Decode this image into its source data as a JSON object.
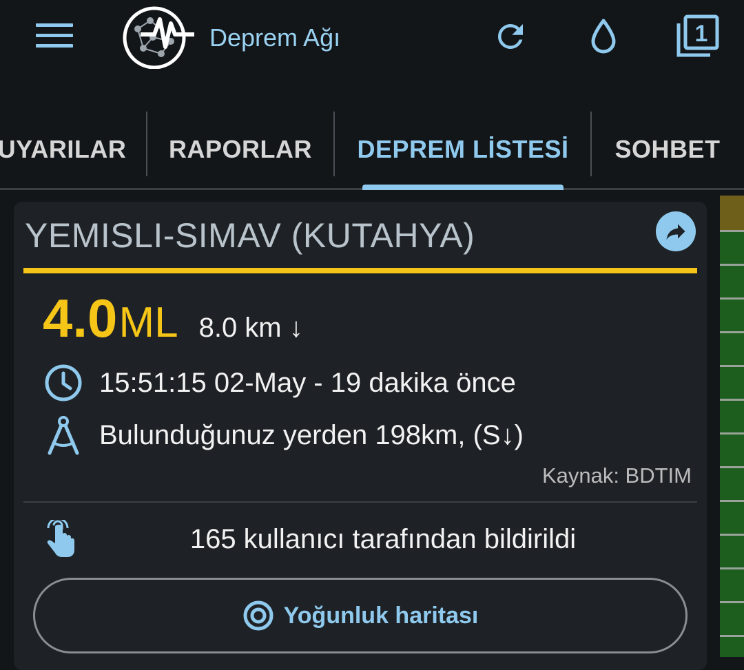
{
  "appbar": {
    "title": "Deprem Ağı",
    "icons": {
      "menu": "hamburger-menu-icon",
      "logo": "earthquake-network-logo",
      "refresh": "refresh-icon",
      "drop": "water-drop-icon",
      "filter": "filter-one-icon"
    },
    "badge_count": "1"
  },
  "tabs": [
    {
      "label": "UYARILAR",
      "active": false
    },
    {
      "label": "RAPORLAR",
      "active": false
    },
    {
      "label": "DEPREM LİSTESİ",
      "active": true
    },
    {
      "label": "SOHBET",
      "active": false
    }
  ],
  "quake": {
    "location": "YEMISLI-SIMAV (KUTAHYA)",
    "magnitude": "4.0",
    "magnitude_unit": "ML",
    "depth": "8.0 km ↓",
    "time": "15:51:15 02-May - 19 dakika önce",
    "distance": "Bulunduğunuz yerden 198km, (S↓)",
    "source": "Kaynak: BDTIM",
    "reports": "165 kullanıcı tarafından bildirildi",
    "map_button": "Yoğunluk haritası",
    "icons": {
      "share": "share-icon",
      "clock": "clock-icon",
      "compass": "drafting-compass-icon",
      "touch": "hand-touch-icon",
      "target": "target-icon"
    }
  },
  "colors": {
    "background": "#131619",
    "card": "#1e2226",
    "accent": "#8fcaee",
    "magnitude": "#f5c518",
    "text": "#f2f2f2",
    "edge_green": "#1d5d1d",
    "edge_olive": "#6e5f1b"
  }
}
